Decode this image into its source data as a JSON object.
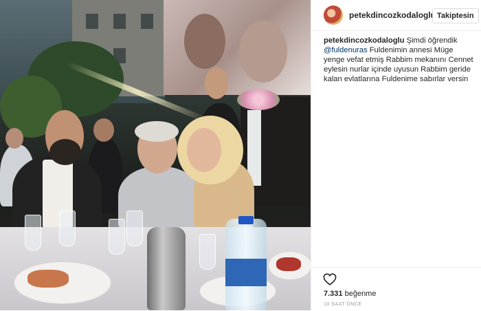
{
  "post": {
    "username": "petekdincozkodaloglu",
    "follow_label": "Takiptesin",
    "caption": {
      "user": "petekdincozkodaloglu",
      "text_part1": "Şimdi öğrendik",
      "mention": "@fuldenuras",
      "text_part2": "Fuldenimin annesi Müge yenge vefat etmiş Rabbim mekanını Cennet eylesin nurlar içinde uyusun Rabbim geride kalan evlatlarına Fuldenime sabırlar versin"
    },
    "likes_count": "7.331",
    "likes_label": "beğenme",
    "time_ago": "10 SAAT ÖNCE"
  },
  "icons": {
    "heart": "heart-icon"
  }
}
